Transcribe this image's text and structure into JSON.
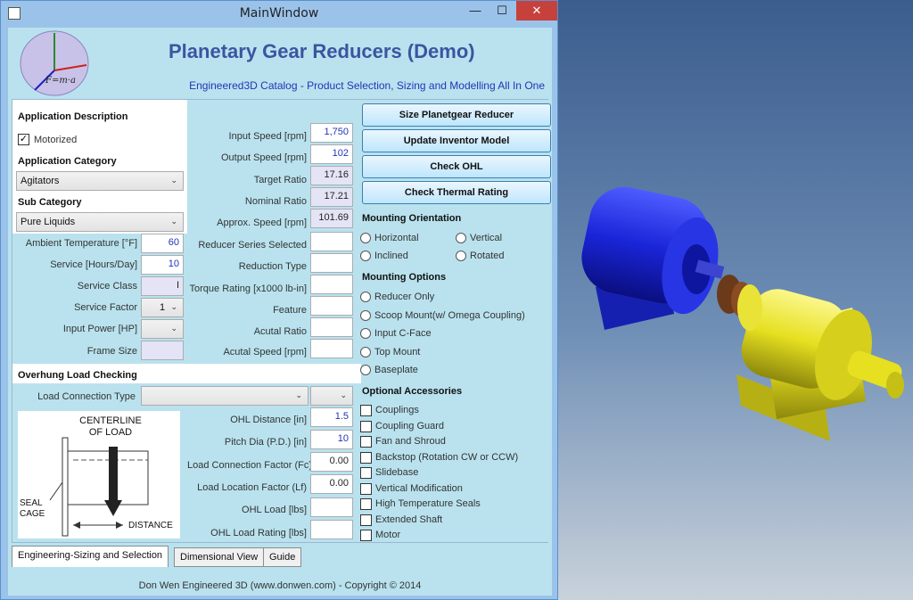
{
  "window": {
    "title": "MainWindow",
    "minimize": "—",
    "maximize": "☐",
    "close": "✕"
  },
  "header": {
    "title": "Planetary Gear Reducers (Demo)",
    "subtitle": "Engineered3D Catalog - Product Selection, Sizing and Modelling All In One",
    "logo_text": "F=m·a"
  },
  "application": {
    "description_header": "Application Description",
    "motorized_label": "Motorized",
    "motorized_checked": true,
    "category_header": "Application Category",
    "category_value": "Agitators",
    "sub_category_header": "Sub Category",
    "sub_category_value": "Pure Liquids",
    "ambient_temp_label": "Ambient Temperature [°F]",
    "ambient_temp_value": "60",
    "service_hours_label": "Service [Hours/Day]",
    "service_hours_value": "10",
    "service_class_label": "Service Class",
    "service_class_value": "I",
    "service_factor_label": "Service Factor",
    "service_factor_value": "1",
    "input_power_label": "Input Power [HP]",
    "input_power_value": "",
    "frame_size_label": "Frame Size",
    "frame_size_value": ""
  },
  "middle": {
    "input_speed_label": "Input Speed [rpm]",
    "input_speed_value": "1,750",
    "output_speed_label": "Output Speed [rpm]",
    "output_speed_value": "102",
    "target_ratio_label": "Target Ratio",
    "target_ratio_value": "17.16",
    "nominal_ratio_label": "Nominal Ratio",
    "nominal_ratio_value": "17.21",
    "approx_speed_label": "Approx. Speed [rpm]",
    "approx_speed_value": "101.69",
    "reducer_series_label": "Reducer Series Selected",
    "reduction_type_label": "Reduction Type",
    "torque_rating_label": "Torque Rating [x1000 lb-in]",
    "feature_label": "Feature",
    "actual_ratio_label": "Acutal Ratio",
    "actual_speed_label": "Acutal Speed [rpm]"
  },
  "ohl": {
    "header": "Overhung Load Checking",
    "load_connection_type_label": "Load Connection Type",
    "ohl_distance_label": "OHL Distance [in]",
    "ohl_distance_value": "1.5",
    "pitch_dia_label": "Pitch Dia (P.D.) [in]",
    "pitch_dia_value": "10",
    "load_connection_factor_label": "Load Connection Factor (Fc)",
    "load_connection_factor_value": "0.00",
    "load_location_factor_label": "Load Location Factor (Lf)",
    "load_location_factor_value": "0.00",
    "ohl_load_label": "OHL Load [lbs]",
    "ohl_load_rating_label": "OHL Load Rating [lbs]",
    "diagram": {
      "centerline": "CENTERLINE",
      "of_load": "OF LOAD",
      "seal": "SEAL",
      "cage": "CAGE",
      "distance": "DISTANCE"
    }
  },
  "actions": {
    "size_button": "Size Planetgear Reducer",
    "update_button": "Update Inventor Model",
    "check_ohl_button": "Check OHL",
    "check_thermal_button": "Check Thermal Rating"
  },
  "mounting_orientation": {
    "header": "Mounting Orientation",
    "options": [
      "Horizontal",
      "Vertical",
      "Inclined",
      "Rotated"
    ]
  },
  "mounting_options": {
    "header": "Mounting Options",
    "options": [
      "Reducer Only",
      "Scoop Mount(w/ Omega Coupling)",
      "Input C-Face",
      "Top Mount",
      "Baseplate"
    ]
  },
  "accessories": {
    "header": "Optional Accessories",
    "items": [
      "Couplings",
      "Coupling Guard",
      "Fan and Shroud",
      "Backstop (Rotation CW or CCW)",
      "Slidebase",
      "Vertical Modification",
      "High Temperature Seals",
      "Extended Shaft",
      "Motor"
    ]
  },
  "tabs": [
    "Engineering-Sizing and Selection",
    "Dimensional View",
    "Guide"
  ],
  "footer": {
    "copyright": "Don Wen Engineered 3D (www.donwen.com) - Copyright © 2014"
  },
  "colors": {
    "motor_blue": "#1a25d8",
    "gear_yellow": "#e6e020",
    "title_blue": "#3b55a0"
  }
}
